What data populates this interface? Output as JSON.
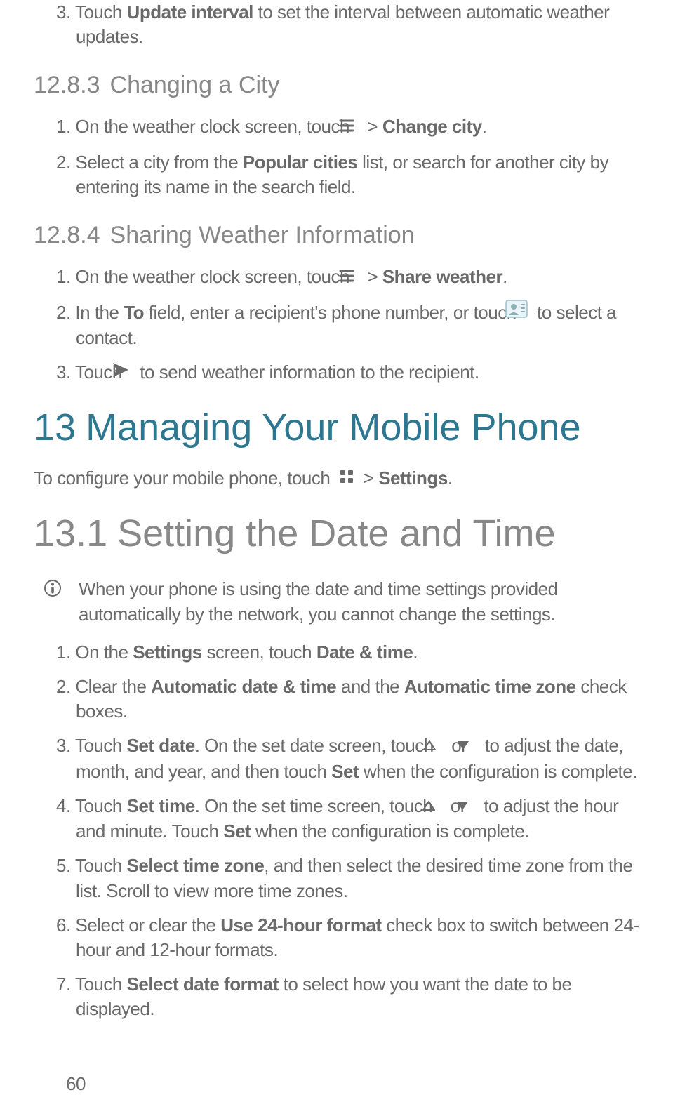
{
  "s1": {
    "step3_pre": "3. Touch ",
    "step3_b": "Update interval",
    "step3_post": " to set the interval between automatic weather updates."
  },
  "h_12_8_3": {
    "num": "12.8.3",
    "title": "Changing a City"
  },
  "s2": {
    "step1_pre": "1. On the weather clock screen, touch ",
    "step1_gt": " > ",
    "step1_b": "Change city",
    "step1_post": ".",
    "step2_pre": "2. Select a city from the ",
    "step2_b": "Popular cities",
    "step2_post": " list, or search for another city by entering its name in the search field."
  },
  "h_12_8_4": {
    "num": "12.8.4",
    "title": "Sharing Weather Information"
  },
  "s3": {
    "step1_pre": "1. On the weather clock screen, touch ",
    "step1_gt": " > ",
    "step1_b": "Share weather",
    "step1_post": ".",
    "step2_pre": "2. In the ",
    "step2_b": "To",
    "step2_mid": " field, enter a recipient's phone number, or touch ",
    "step2_post": " to select a contact.",
    "step3_pre": "3. Touch ",
    "step3_post": " to send weather information to the recipient."
  },
  "h_13": {
    "num": "13",
    "title": "Managing Your Mobile Phone"
  },
  "p13": {
    "pre": "To configure your mobile phone, touch ",
    "gt": " > ",
    "b": "Settings",
    "post": "."
  },
  "h_13_1": {
    "num": "13.1",
    "title": "Setting the Date and Time"
  },
  "note": "When your phone is using the date and time settings provided automatically by the network, you cannot change the settings.",
  "s4": {
    "step1_pre": "1. On the ",
    "step1_b1": "Settings",
    "step1_mid": " screen, touch ",
    "step1_b2": "Date & time",
    "step1_post": ".",
    "step2_pre": "2. Clear the ",
    "step2_b1": "Automatic date & time",
    "step2_mid": " and the ",
    "step2_b2": "Automatic time zone",
    "step2_post": " check boxes.",
    "step3_pre": "3. Touch ",
    "step3_b1": "Set date",
    "step3_mid1": ". On the set date screen, touch ",
    "step3_or": " or ",
    "step3_mid2": " to adjust the date, month, and year, and then touch ",
    "step3_b2": "Set",
    "step3_post": " when the configuration is complete.",
    "step4_pre": "4. Touch ",
    "step4_b1": "Set time",
    "step4_mid1": ". On the set time screen, touch ",
    "step4_or": " or ",
    "step4_mid2": " to adjust the hour and minute. Touch ",
    "step4_b2": "Set",
    "step4_post": " when the configuration is complete.",
    "step5_pre": "5. Touch ",
    "step5_b": "Select time zone",
    "step5_post": ", and then select the desired time zone from the list. Scroll to view more time zones.",
    "step6_pre": "6. Select or clear the ",
    "step6_b": "Use 24-hour format",
    "step6_post": " check box to switch between 24-hour and 12-hour formats.",
    "step7_pre": "7. Touch ",
    "step7_b": "Select date format",
    "step7_post": " to select how you want the date to be displayed."
  },
  "page_number": "60"
}
